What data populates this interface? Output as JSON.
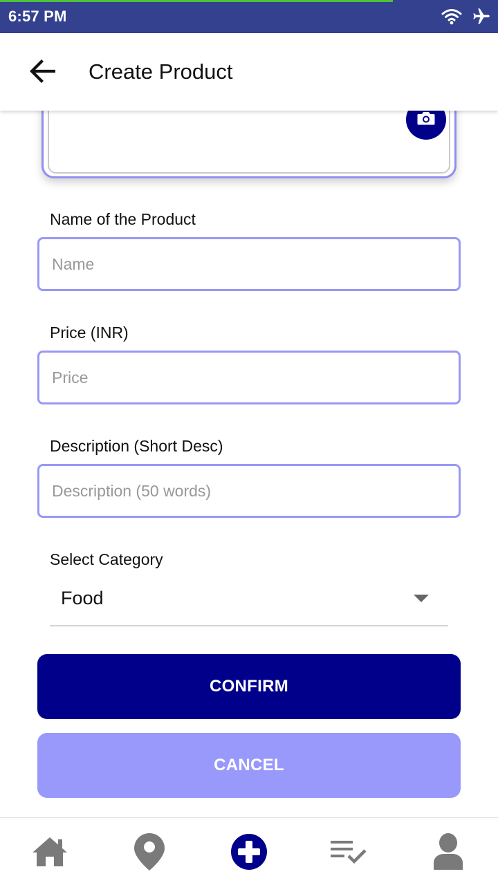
{
  "status_bar": {
    "time": "6:57 PM",
    "icons": [
      "wifi-icon",
      "airplane-icon"
    ]
  },
  "app_bar": {
    "title": "Create Product",
    "back_icon": "arrow-left-icon"
  },
  "image_picker": {
    "icon": "camera-icon"
  },
  "form": {
    "name": {
      "label": "Name of the Product",
      "placeholder": "Name",
      "value": ""
    },
    "price": {
      "label": "Price (INR)",
      "placeholder": "Price",
      "value": ""
    },
    "description": {
      "label": "Description (Short Desc)",
      "placeholder": "Description (50 words)",
      "value": ""
    },
    "category": {
      "label": "Select Category",
      "selected": "Food"
    }
  },
  "actions": {
    "confirm_label": "CONFIRM",
    "cancel_label": "CANCEL"
  },
  "bottom_nav": {
    "items": [
      {
        "icon": "home-icon",
        "active": false
      },
      {
        "icon": "location-pin-icon",
        "active": false
      },
      {
        "icon": "add-circle-icon",
        "active": true
      },
      {
        "icon": "checklist-icon",
        "active": false
      },
      {
        "icon": "person-icon",
        "active": false
      }
    ]
  },
  "colors": {
    "status_bar": "#33418f",
    "primary": "#00008b",
    "secondary": "#9999fb",
    "input_border": "#9999f5",
    "nav_inactive": "#777777"
  }
}
